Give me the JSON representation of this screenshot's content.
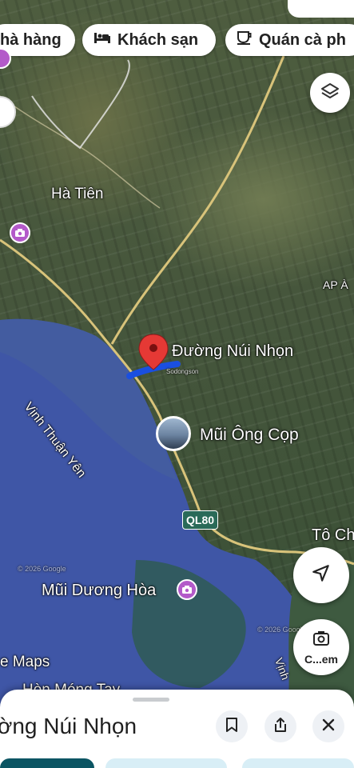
{
  "filters": [
    {
      "label": "hà hàng",
      "icon": "restaurant-icon"
    },
    {
      "label": "Khách sạn",
      "icon": "hotel-bed-icon"
    },
    {
      "label": "Quán cà ph",
      "icon": "coffee-cup-icon"
    }
  ],
  "map_labels": {
    "ha_tien": "Hà Tiên",
    "ap_a": "AP À",
    "duong_nui_nhon": "Đường Núi Nhọn",
    "vinh_thuan_yen": "Vịnh Thuận Yên",
    "mui_ong_cop": "Mũi Ông Cọp",
    "ql80": "QL80",
    "to_ch": "Tô Ch",
    "mui_duong_hoa": "Mũi Dương Hòa",
    "maps_watermark": "e Maps",
    "hon_mong_tay": "Hòn Móng Tay",
    "copyright_1": "© 2026 Google",
    "copyright_2": "© 2026 Google",
    "vinh_edge": "Vịnh",
    "road_marker_label": "Sodongson"
  },
  "controls": {
    "layers": "layers-icon",
    "navigate": "navigation-arrow-icon",
    "lens_label": "C...em"
  },
  "sheet": {
    "title": "ờng Núi Nhọn"
  },
  "colors": {
    "route": "#1a4fe0",
    "pin": "#e53935",
    "poi": "#b35ac9",
    "water": "#3f56a6",
    "road": "#d8c37a"
  }
}
